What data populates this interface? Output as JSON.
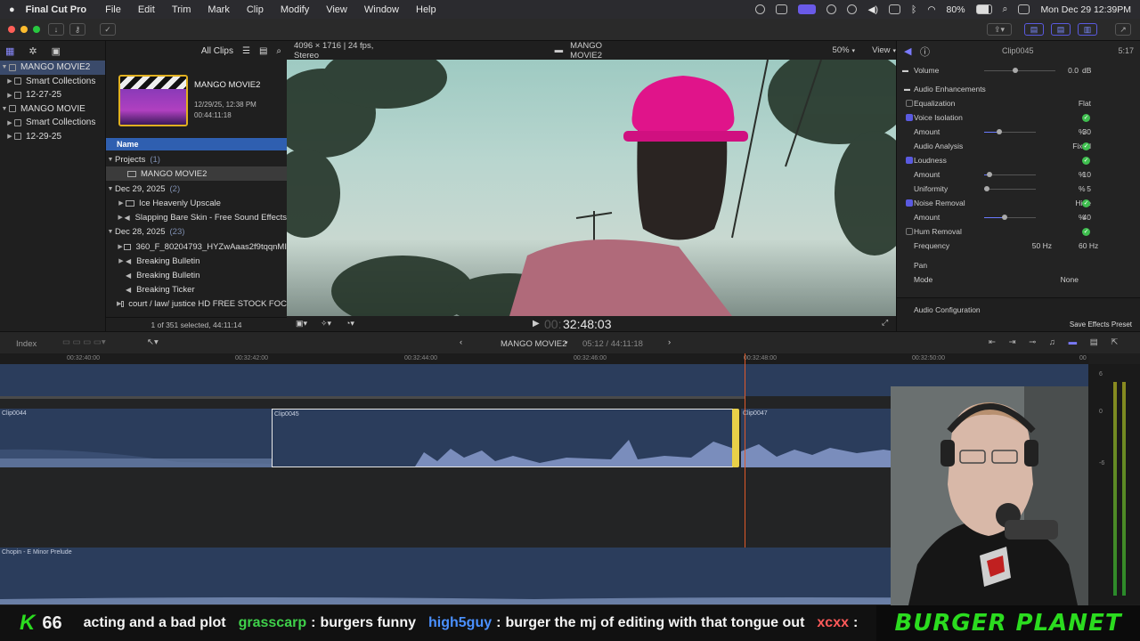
{
  "menubar": {
    "app": "Final Cut Pro",
    "items": [
      "File",
      "Edit",
      "Trim",
      "Mark",
      "Clip",
      "Modify",
      "View",
      "Window",
      "Help"
    ],
    "battery": "80%",
    "datetime": "Mon Dec 29  12:39PM"
  },
  "library": {
    "rows": [
      {
        "label": "MANGO MOVIE2",
        "level": 0,
        "selected": true
      },
      {
        "label": "Smart Collections",
        "level": 1,
        "selected": false
      },
      {
        "label": "12-27-25",
        "level": 1,
        "selected": false
      },
      {
        "label": "MANGO MOVIE",
        "level": 0,
        "selected": false
      },
      {
        "label": "Smart Collections",
        "level": 1,
        "selected": false
      },
      {
        "label": "12-29-25",
        "level": 1,
        "selected": false
      }
    ]
  },
  "browser": {
    "filter": "All Clips",
    "project_title": "MANGO MOVIE2",
    "project_date": "12/29/25, 12:38 PM",
    "project_duration": "00:44:11:18",
    "column_name": "Name",
    "groups": [
      {
        "label": "Projects",
        "count": "(1)"
      },
      {
        "label": "Dec 29, 2025",
        "count": "(2)"
      },
      {
        "label": "Dec 28, 2025",
        "count": "(23)"
      }
    ],
    "items": [
      "MANGO MOVIE2",
      "Ice Heavenly Upscale",
      "Slapping Bare Skin - Free Sound Effects",
      "360_F_80204793_HYZwAaas2f9tqqnMI",
      "Breaking Bulletin",
      "Breaking Bulletin",
      "Breaking Ticker",
      "court / law/ justice HD FREE STOCK FOC"
    ],
    "footer": "1 of 351 selected, 44:11:14"
  },
  "viewer": {
    "format": "4096 × 1716 | 24 fps, Stereo",
    "title": "MANGO MOVIE2",
    "zoom": "50%",
    "view_label": "View",
    "timecode": "32:48:03",
    "timecode_prefix": "00:"
  },
  "inspector": {
    "clip": "Clip0045",
    "duration": "5:17",
    "volume_label": "Volume",
    "volume_value": "0.0",
    "volume_unit": "dB",
    "section": "Audio Enhancements",
    "rows": [
      {
        "label": "Equalization",
        "value": "Flat",
        "checkbox": "off"
      },
      {
        "label": "Voice Isolation",
        "checkbox": "on"
      },
      {
        "label": "Amount",
        "value": "30",
        "unit": "%",
        "slider": 0.3
      },
      {
        "label": "Audio Analysis",
        "value": "Fixed"
      },
      {
        "label": "Loudness",
        "checkbox": "on"
      },
      {
        "label": "Amount",
        "value": "10",
        "unit": "%",
        "slider": 0.1
      },
      {
        "label": "Uniformity",
        "value": "5",
        "unit": "%",
        "slider": 0.05
      },
      {
        "label": "Noise Removal",
        "value": "Hide",
        "checkbox": "on"
      },
      {
        "label": "Amount",
        "value": "40",
        "unit": "%",
        "slider": 0.4
      },
      {
        "label": "Hum Removal",
        "checkbox": "off"
      },
      {
        "label": "Frequency",
        "value": "50 Hz",
        "unit": "60 Hz"
      }
    ],
    "pan_section": "Pan",
    "mode_label": "Mode",
    "mode_value": "None",
    "audio_config": "Audio Configuration",
    "save_preset": "Save Effects Preset"
  },
  "timeline": {
    "index_label": "Index",
    "project": "MANGO MOVIE2",
    "position": "05:12 / 44:11:18",
    "ruler": [
      "00:32:40:00",
      "00:32:42:00",
      "00:32:44:00",
      "00:32:46:00",
      "00:32:48:00",
      "00:32:50:00",
      "00"
    ],
    "clips": [
      "Clip0044",
      "Clip0045",
      "Clip0047"
    ],
    "music": "Chopin - E Minor Prelude",
    "meter": [
      "6",
      "0",
      "-6"
    ]
  },
  "chat": {
    "emote": "K",
    "count": "66",
    "lead": "acting and a bad plot",
    "messages": [
      {
        "user": "grasscarp",
        "text": "burgers funny",
        "color": "#3fd14a"
      },
      {
        "user": "high5guy",
        "text": "burger the mj of editing with that tongue out",
        "color": "#4a90ff"
      },
      {
        "user": "xcxx",
        "text": "",
        "color": "#ff5a5a"
      }
    ],
    "banner": "BURGER PLANET"
  }
}
